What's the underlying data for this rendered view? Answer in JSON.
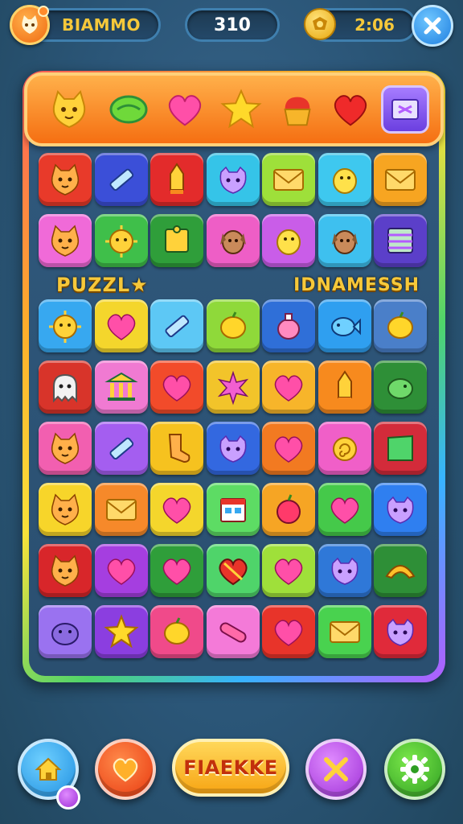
{
  "hud": {
    "player_name": "BIAMMO",
    "score": "310",
    "timer": "2:06"
  },
  "banner": {
    "left_text": "PUZZL★",
    "right_text": "IDNAMESSH"
  },
  "bottom_bar": {
    "play_label": "FIAEKKE"
  },
  "shelf_icons": [
    "cat-face-icon",
    "green-candy-icon",
    "heart-icon",
    "star-icon",
    "cupcake-icon",
    "red-heart-icon",
    "gift-box-icon"
  ],
  "board": {
    "rows": [
      [
        {
          "c": "#e83a2a",
          "i": "cat-face"
        },
        {
          "c": "#3b4fd8",
          "i": "pencil"
        },
        {
          "c": "#e32b2b",
          "i": "rocket"
        },
        {
          "c": "#35c4e8",
          "i": "monster"
        },
        {
          "c": "#9ee03a",
          "i": "envelope"
        },
        {
          "c": "#3ec8ef",
          "i": "chick"
        },
        {
          "c": "#f7a521",
          "i": "envelope"
        }
      ],
      [
        {
          "c": "#f06ad8",
          "i": "cat-face"
        },
        {
          "c": "#3fbf4a",
          "i": "sun-face"
        },
        {
          "c": "#2f9e3a",
          "i": "puzzle"
        },
        {
          "c": "#ee5ec6",
          "i": "dog"
        },
        {
          "c": "#c95de8",
          "i": "chick"
        },
        {
          "c": "#3ec0ef",
          "i": "dog"
        },
        {
          "c": "#5b3fc9",
          "i": "book"
        }
      ],
      [
        {
          "c": "#37a8f0",
          "i": "sun-face"
        },
        {
          "c": "#f4d62c",
          "i": "heart"
        },
        {
          "c": "#5dc8f5",
          "i": "pencil"
        },
        {
          "c": "#8fd93a",
          "i": "lemon"
        },
        {
          "c": "#2f6fd8",
          "i": "potion"
        },
        {
          "c": "#2f9ff0",
          "i": "fish"
        },
        {
          "c": "#4a7fc9",
          "i": "lemon"
        }
      ],
      [
        {
          "c": "#d8342a",
          "i": "ghost"
        },
        {
          "c": "#f07ad2",
          "i": "temple"
        },
        {
          "c": "#f24b2a",
          "i": "heart"
        },
        {
          "c": "#f2c42a",
          "i": "splash"
        },
        {
          "c": "#f7b52a",
          "i": "heart"
        },
        {
          "c": "#f78a1e",
          "i": "rocket"
        },
        {
          "c": "#2e8f37",
          "i": "bird"
        }
      ],
      [
        {
          "c": "#f25fb0",
          "i": "cat-face"
        },
        {
          "c": "#a45ef0",
          "i": "pencil"
        },
        {
          "c": "#f6c21f",
          "i": "sock"
        },
        {
          "c": "#3368e0",
          "i": "monster"
        },
        {
          "c": "#f27a21",
          "i": "heart"
        },
        {
          "c": "#f05fc8",
          "i": "swirl"
        },
        {
          "c": "#d32b3a",
          "i": "flag"
        }
      ],
      [
        {
          "c": "#f7d52a",
          "i": "cat-face"
        },
        {
          "c": "#f6892a",
          "i": "envelope"
        },
        {
          "c": "#f4d62c",
          "i": "heart"
        },
        {
          "c": "#5ddc64",
          "i": "house"
        },
        {
          "c": "#f6a524",
          "i": "apple"
        },
        {
          "c": "#45c94a",
          "i": "heart"
        },
        {
          "c": "#2f7ff0",
          "i": "monster"
        }
      ],
      [
        {
          "c": "#d8262a",
          "i": "cat-face"
        },
        {
          "c": "#a53ee0",
          "i": "heart"
        },
        {
          "c": "#2f9e3a",
          "i": "heart"
        },
        {
          "c": "#4fd46a",
          "i": "broken-heart"
        },
        {
          "c": "#9fe03a",
          "i": "heart"
        },
        {
          "c": "#2f78d8",
          "i": "monster"
        },
        {
          "c": "#2e8f37",
          "i": "croissant"
        }
      ],
      [
        {
          "c": "#9a72f0",
          "i": "seal"
        },
        {
          "c": "#8b3ee0",
          "i": "star"
        },
        {
          "c": "#f04a8a",
          "i": "lemon"
        },
        {
          "c": "#f47ad8",
          "i": "sausage"
        },
        {
          "c": "#e8342a",
          "i": "heart"
        },
        {
          "c": "#49d24f",
          "i": "envelope"
        },
        {
          "c": "#e02a3a",
          "i": "monster"
        }
      ]
    ]
  },
  "colors": {
    "background": "#2b5678",
    "accent_gold": "#f6c83a",
    "shelf_orange": "#f56f12"
  }
}
